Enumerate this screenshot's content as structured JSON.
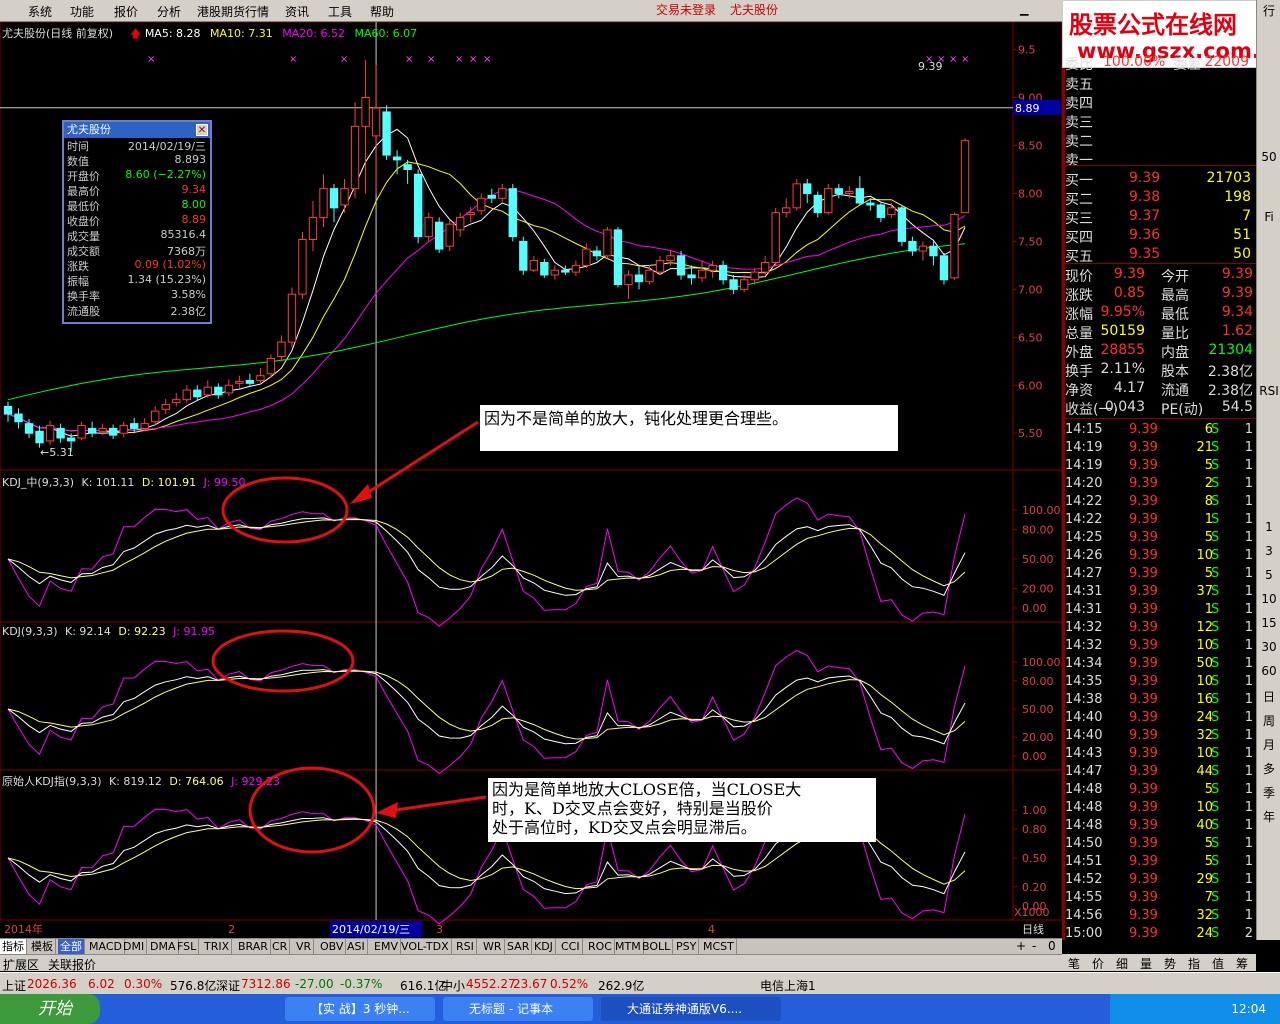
{
  "menu": [
    "系统",
    "功能",
    "报价",
    "分析",
    "港股期货行情",
    "资讯",
    "工具",
    "帮助"
  ],
  "login_status": "交易未登录",
  "stock_name_top": "尤夫股份",
  "brand": {
    "line1": "股票公式在线网",
    "line2": "www.gszx.com.cn"
  },
  "main_title": "尤夫股份(日线 前复权)",
  "ma": [
    {
      "label": "MA5: 8.28",
      "color": "#ffffff"
    },
    {
      "label": "MA10: 7.31",
      "color": "#ffff00"
    },
    {
      "label": "MA20: 6.52",
      "color": "#ff00ff"
    },
    {
      "label": "MA60: 6.07",
      "color": "#00ff00"
    }
  ],
  "price_axis": [
    "9.5",
    "9.00",
    "8.50",
    "8.00",
    "7.50",
    "7.00",
    "6.50",
    "6.00",
    "5.50"
  ],
  "crosshair_price": "8.89",
  "high_label": "9.39",
  "low_label": "5.31",
  "infobox": {
    "title": "尤夫股份",
    "rows": [
      {
        "k": "时间",
        "v": "2014/02/19/三",
        "c": "#cccccc"
      },
      {
        "k": "数值",
        "v": "8.893",
        "c": "#cccccc"
      },
      {
        "k": "开盘价",
        "v": "8.60 (−2.27%)",
        "c": "#00ff00"
      },
      {
        "k": "最高价",
        "v": "9.34",
        "c": "#ff3030"
      },
      {
        "k": "最低价",
        "v": "8.00",
        "c": "#00ff00"
      },
      {
        "k": "收盘价",
        "v": "8.89",
        "c": "#ff3030"
      },
      {
        "k": "成交量",
        "v": "85316.4",
        "c": "#cccccc"
      },
      {
        "k": "成交额",
        "v": "7368万",
        "c": "#cccccc"
      },
      {
        "k": "涨跌",
        "v": "0.09 (1.02%)",
        "c": "#ff3030"
      },
      {
        "k": "振幅",
        "v": "1.34 (15.23%)",
        "c": "#cccccc"
      },
      {
        "k": "换手率",
        "v": "3.58%",
        "c": "#cccccc"
      },
      {
        "k": "流通股",
        "v": "2.38亿",
        "c": "#cccccc"
      }
    ]
  },
  "note1": "因为不是简单的放大，钝化处理更合理些。",
  "note2": [
    "因为是简单地放大CLOSE倍，当CLOSE大",
    "时，K、D交叉点会变好，特别是当股价",
    "处于高位时，KD交叉点会明显滞后。"
  ],
  "kdj1": {
    "name": "KDJ_中(9,3,3)",
    "k": "K: 101.11",
    "d": "D: 101.91",
    "j": "J: 99.50",
    "axis": [
      "100.00",
      "80.00",
      "50.00",
      "20.00",
      "0.00"
    ]
  },
  "kdj2": {
    "name": "KDJ(9,3,3)",
    "k": "K: 92.14",
    "d": "D: 92.23",
    "j": "J: 91.95",
    "axis": [
      "100.00",
      "80.00",
      "50.00",
      "20.00",
      "0.00"
    ]
  },
  "kdj3": {
    "name": "原始人KDJ指(9,3,3)",
    "k": "K: 819.12",
    "d": "D: 764.06",
    "j": "J: 929.23",
    "axis": [
      "1.00",
      "0.80",
      "0.50",
      "0.20",
      "0.00"
    ],
    "unit": "X1000"
  },
  "date_axis": {
    "left": "2014年",
    "m2": "2",
    "m3": "3",
    "m4": "4",
    "cursor": "2014/02/19/三",
    "period": "日线"
  },
  "orderbook": {
    "sell": [
      "卖五",
      "卖四",
      "卖三",
      "卖二",
      "卖一"
    ],
    "buy": [
      {
        "k": "买一",
        "p": "9.39",
        "v": "21703"
      },
      {
        "k": "买二",
        "p": "9.38",
        "v": "198"
      },
      {
        "k": "买三",
        "p": "9.37",
        "v": "7"
      },
      {
        "k": "买四",
        "p": "9.36",
        "v": "51"
      },
      {
        "k": "买五",
        "p": "9.35",
        "v": "50"
      }
    ],
    "wb_label": "委比",
    "wb_val": "100.00%",
    "wc_label": "委差",
    "wc_val": "22009"
  },
  "quote": [
    {
      "k1": "现价",
      "v1": "9.39",
      "c1": "#ff3030",
      "k2": "今开",
      "v2": "9.39",
      "c2": "#ff3030"
    },
    {
      "k1": "涨跌",
      "v1": "0.85",
      "c1": "#ff3030",
      "k2": "最高",
      "v2": "9.39",
      "c2": "#ff3030"
    },
    {
      "k1": "涨幅",
      "v1": "9.95%",
      "c1": "#ff3030",
      "k2": "最低",
      "v2": "9.34",
      "c2": "#ff3030"
    },
    {
      "k1": "总量",
      "v1": "50159",
      "c1": "#ffff00",
      "k2": "量比",
      "v2": "1.62",
      "c2": "#ff3030"
    },
    {
      "k1": "外盘",
      "v1": "28855",
      "c1": "#ff3030",
      "k2": "内盘",
      "v2": "21304",
      "c2": "#00ff00"
    },
    {
      "k1": "换手",
      "v1": "2.11%",
      "c1": "#dddddd",
      "k2": "股本",
      "v2": "2.38亿",
      "c2": "#dddddd"
    },
    {
      "k1": "净资",
      "v1": "4.17",
      "c1": "#dddddd",
      "k2": "流通",
      "v2": "2.38亿",
      "c2": "#dddddd"
    },
    {
      "k1": "收益(一)",
      "v1": "0.043",
      "c1": "#dddddd",
      "k2": "PE(动)",
      "v2": "54.5",
      "c2": "#dddddd"
    }
  ],
  "ticks": [
    [
      "14:15",
      "9.39",
      "6",
      "S",
      "1"
    ],
    [
      "14:19",
      "9.39",
      "21",
      "S",
      "1"
    ],
    [
      "14:19",
      "9.39",
      "5",
      "S",
      "1"
    ],
    [
      "14:20",
      "9.39",
      "2",
      "S",
      "1"
    ],
    [
      "14:22",
      "9.39",
      "8",
      "S",
      "1"
    ],
    [
      "14:22",
      "9.39",
      "1",
      "S",
      "1"
    ],
    [
      "14:25",
      "9.39",
      "5",
      "S",
      "1"
    ],
    [
      "14:26",
      "9.39",
      "10",
      "S",
      "1"
    ],
    [
      "14:27",
      "9.39",
      "5",
      "S",
      "1"
    ],
    [
      "14:31",
      "9.39",
      "37",
      "S",
      "1"
    ],
    [
      "14:31",
      "9.39",
      "1",
      "S",
      "1"
    ],
    [
      "14:32",
      "9.39",
      "12",
      "S",
      "1"
    ],
    [
      "14:32",
      "9.39",
      "10",
      "S",
      "1"
    ],
    [
      "14:34",
      "9.39",
      "50",
      "S",
      "1"
    ],
    [
      "14:35",
      "9.39",
      "10",
      "S",
      "1"
    ],
    [
      "14:38",
      "9.39",
      "16",
      "S",
      "1"
    ],
    [
      "14:40",
      "9.39",
      "24",
      "S",
      "1"
    ],
    [
      "14:40",
      "9.39",
      "32",
      "S",
      "1"
    ],
    [
      "14:43",
      "9.39",
      "10",
      "S",
      "1"
    ],
    [
      "14:47",
      "9.39",
      "44",
      "S",
      "1"
    ],
    [
      "14:48",
      "9.39",
      "5",
      "S",
      "1"
    ],
    [
      "14:48",
      "9.39",
      "10",
      "S",
      "1"
    ],
    [
      "14:48",
      "9.39",
      "40",
      "S",
      "1"
    ],
    [
      "14:50",
      "9.39",
      "5",
      "S",
      "1"
    ],
    [
      "14:51",
      "9.39",
      "5",
      "S",
      "1"
    ],
    [
      "14:52",
      "9.39",
      "29",
      "S",
      "1"
    ],
    [
      "14:55",
      "9.39",
      "7",
      "S",
      "1"
    ],
    [
      "14:56",
      "9.39",
      "32",
      "S",
      "1"
    ],
    [
      "15:00",
      "9.39",
      "24",
      "S",
      "2"
    ]
  ],
  "indicator_tabs": [
    "指标",
    "模板",
    "全部",
    "MACD",
    "DMI",
    "DMA",
    "FSL",
    "TRIX",
    "BRAR",
    "CR",
    "VR",
    "OBV",
    "ASI",
    "EMV",
    "VOL-TDX",
    "RSI",
    "WR",
    "SAR",
    "KDJ",
    "CCI",
    "ROC",
    "MTM",
    "BOLL",
    "PSY",
    "MCST"
  ],
  "sub_tabs": [
    "扩展区",
    "关联报价"
  ],
  "right_tabs": [
    "笔",
    "价",
    "细",
    "量",
    "势",
    "指",
    "值",
    "筹"
  ],
  "vtoolbar": [
    "行",
    "50",
    "Fi",
    "RSI",
    "1",
    "3",
    "5",
    "10",
    "15",
    "30",
    "60",
    "日",
    "周",
    "月",
    "多",
    "季",
    "年"
  ],
  "status": {
    "sh_label": "上证",
    "sh_val": "2026.36",
    "sh_chg": "6.02",
    "sh_pct": "0.30%",
    "sh_amt": "576.8亿",
    "sz_label": "深证",
    "sz_val": "7312.86",
    "sz_chg": "-27.00",
    "sz_pct": "-0.37%",
    "sz_amt": "616.1亿",
    "zx_label": "中小",
    "zx_val": "4552.27",
    "zx_chg": "23.67",
    "zx_pct": "0.52%",
    "zx_amt": "262.9亿",
    "server": "电信上海1"
  },
  "taskbar": {
    "start": "开始",
    "items": [
      "【实  战】3 秒钟...",
      "无标题 - 记事本",
      "大通证券神通版V6...."
    ],
    "time": "12:04"
  },
  "chart_data": {
    "type": "candlestick",
    "title": "尤夫股份(日线 前复权)",
    "ylim": [
      5.2,
      9.6
    ],
    "cursor_date": "2014/02/19/三",
    "cursor_values": {
      "open": 8.6,
      "high": 9.34,
      "low": 8.0,
      "close": 8.89
    },
    "last": {
      "close": 9.39,
      "MA5": 8.28,
      "MA10": 7.31,
      "MA20": 6.52,
      "MA60": 6.07
    },
    "candles": [
      [
        5.78,
        5.7,
        5.83,
        5.62
      ],
      [
        5.7,
        5.62,
        5.76,
        5.55
      ],
      [
        5.6,
        5.5,
        5.65,
        5.45
      ],
      [
        5.52,
        5.4,
        5.58,
        5.35
      ],
      [
        5.42,
        5.58,
        5.63,
        5.38
      ],
      [
        5.55,
        5.45,
        5.6,
        5.4
      ],
      [
        5.45,
        5.42,
        5.5,
        5.31
      ],
      [
        5.45,
        5.58,
        5.62,
        5.43
      ],
      [
        5.55,
        5.5,
        5.62,
        5.46
      ],
      [
        5.52,
        5.55,
        5.6,
        5.48
      ],
      [
        5.55,
        5.48,
        5.59,
        5.44
      ],
      [
        5.5,
        5.58,
        5.62,
        5.46
      ],
      [
        5.6,
        5.55,
        5.66,
        5.5
      ],
      [
        5.55,
        5.6,
        5.66,
        5.52
      ],
      [
        5.62,
        5.73,
        5.78,
        5.58
      ],
      [
        5.75,
        5.8,
        5.86,
        5.7
      ],
      [
        5.82,
        5.85,
        5.92,
        5.78
      ],
      [
        5.85,
        5.95,
        6.0,
        5.82
      ],
      [
        5.95,
        5.88,
        6.0,
        5.84
      ],
      [
        5.9,
        5.98,
        6.05,
        5.87
      ],
      [
        5.98,
        5.9,
        6.02,
        5.86
      ],
      [
        5.92,
        6.0,
        6.06,
        5.89
      ],
      [
        6.02,
        6.04,
        6.1,
        5.97
      ],
      [
        6.05,
        6.02,
        6.12,
        5.98
      ],
      [
        6.05,
        6.1,
        6.18,
        6.0
      ],
      [
        6.12,
        6.28,
        6.32,
        6.08
      ],
      [
        6.3,
        6.45,
        6.52,
        6.25
      ],
      [
        6.45,
        6.95,
        7.02,
        6.4
      ],
      [
        6.95,
        7.52,
        7.6,
        6.9
      ],
      [
        7.52,
        7.75,
        7.92,
        7.4
      ],
      [
        7.75,
        8.05,
        8.2,
        7.65
      ],
      [
        8.05,
        7.85,
        8.1,
        7.7
      ],
      [
        7.88,
        8.05,
        8.15,
        7.8
      ],
      [
        8.05,
        8.7,
        8.95,
        7.95
      ],
      [
        8.7,
        9.0,
        9.39,
        8.0
      ],
      [
        8.6,
        8.89,
        9.34,
        8.0
      ],
      [
        8.85,
        8.4,
        8.92,
        8.35
      ],
      [
        8.38,
        8.35,
        8.45,
        8.2
      ],
      [
        8.3,
        8.25,
        8.35,
        8.1
      ],
      [
        8.2,
        7.55,
        8.25,
        7.48
      ],
      [
        7.55,
        7.75,
        7.8,
        7.5
      ],
      [
        7.7,
        7.42,
        7.75,
        7.38
      ],
      [
        7.45,
        7.68,
        7.72,
        7.4
      ],
      [
        7.62,
        7.75,
        7.8,
        7.55
      ],
      [
        7.78,
        7.8,
        7.86,
        7.7
      ],
      [
        7.82,
        7.95,
        8.0,
        7.78
      ],
      [
        7.98,
        7.95,
        8.05,
        7.9
      ],
      [
        7.95,
        8.05,
        8.1,
        7.9
      ],
      [
        8.05,
        7.55,
        8.1,
        7.5
      ],
      [
        7.5,
        7.2,
        7.55,
        7.15
      ],
      [
        7.2,
        7.3,
        7.35,
        7.18
      ],
      [
        7.28,
        7.15,
        7.32,
        7.12
      ],
      [
        7.15,
        7.2,
        7.25,
        7.1
      ],
      [
        7.2,
        7.18,
        7.25,
        7.15
      ],
      [
        7.18,
        7.25,
        7.3,
        7.14
      ],
      [
        7.25,
        7.42,
        7.48,
        7.22
      ],
      [
        7.4,
        7.35,
        7.45,
        7.3
      ],
      [
        7.35,
        7.62,
        7.65,
        7.32
      ],
      [
        7.62,
        7.05,
        7.65,
        7.02
      ],
      [
        7.05,
        7.15,
        7.2,
        6.9
      ],
      [
        7.15,
        7.08,
        7.25,
        7.0
      ],
      [
        7.08,
        7.2,
        7.25,
        7.05
      ],
      [
        7.18,
        7.3,
        7.35,
        7.15
      ],
      [
        7.3,
        7.35,
        7.4,
        7.25
      ],
      [
        7.35,
        7.15,
        7.4,
        7.1
      ],
      [
        7.15,
        7.12,
        7.25,
        7.05
      ],
      [
        7.12,
        7.2,
        7.3,
        7.08
      ],
      [
        7.2,
        7.25,
        7.3,
        7.12
      ],
      [
        7.25,
        7.1,
        7.3,
        7.05
      ],
      [
        7.1,
        7.0,
        7.15,
        6.95
      ],
      [
        7.0,
        7.1,
        7.15,
        6.97
      ],
      [
        7.1,
        7.18,
        7.22,
        7.05
      ],
      [
        7.18,
        7.28,
        7.35,
        7.15
      ],
      [
        7.28,
        7.8,
        7.85,
        7.25
      ],
      [
        7.8,
        7.85,
        7.95,
        7.75
      ],
      [
        7.85,
        8.1,
        8.15,
        7.82
      ],
      [
        8.1,
        8.0,
        8.15,
        7.9
      ],
      [
        7.98,
        7.8,
        8.02,
        7.75
      ],
      [
        7.8,
        8.05,
        8.1,
        7.78
      ],
      [
        8.05,
        8.0,
        8.1,
        7.95
      ],
      [
        8.0,
        8.02,
        8.08,
        7.95
      ],
      [
        8.05,
        7.9,
        8.18,
        7.88
      ],
      [
        7.9,
        7.88,
        7.95,
        7.82
      ],
      [
        7.88,
        7.75,
        7.9,
        7.7
      ],
      [
        7.78,
        7.85,
        7.9,
        7.74
      ],
      [
        7.85,
        7.5,
        7.88,
        7.45
      ],
      [
        7.5,
        7.4,
        7.55,
        7.35
      ],
      [
        7.4,
        7.45,
        7.5,
        7.3
      ],
      [
        7.45,
        7.35,
        7.5,
        7.25
      ],
      [
        7.35,
        7.1,
        7.38,
        7.05
      ],
      [
        7.12,
        7.78,
        7.8,
        7.1
      ],
      [
        7.8,
        8.55,
        8.58,
        7.85
      ]
    ],
    "series_ma": [
      {
        "name": "MA5",
        "color": "#ffffff"
      },
      {
        "name": "MA10",
        "color": "#ffff00"
      },
      {
        "name": "MA20",
        "color": "#ff00ff"
      },
      {
        "name": "MA60",
        "color": "#00ff00"
      }
    ]
  }
}
